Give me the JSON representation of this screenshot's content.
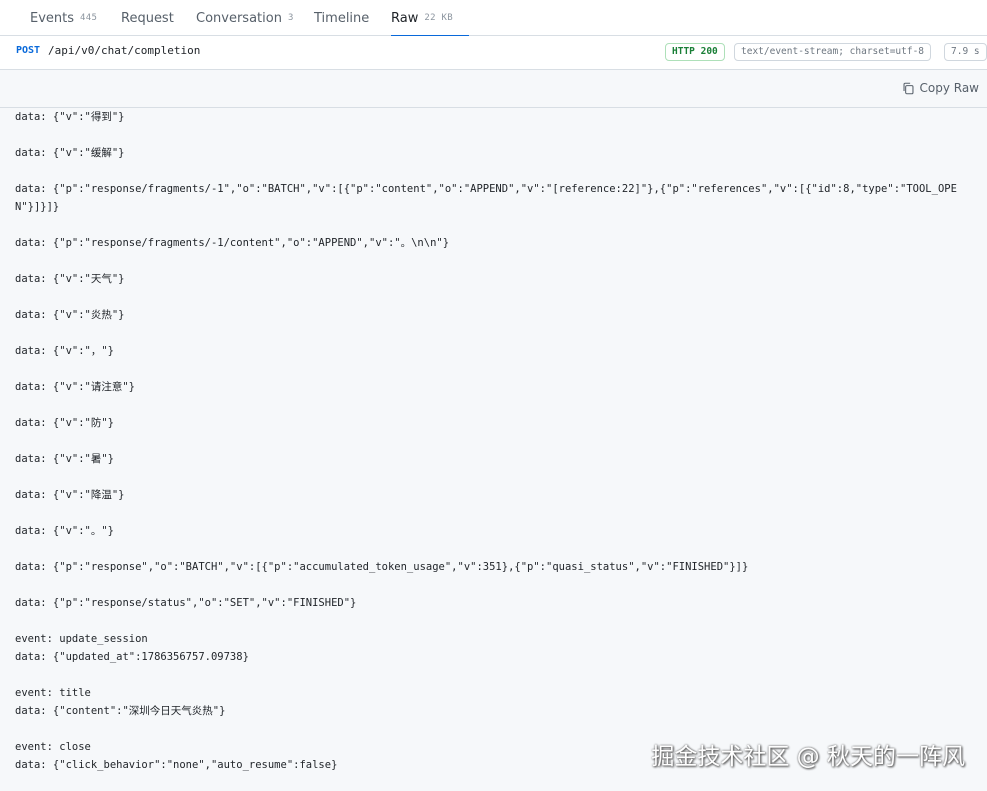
{
  "tabs": [
    {
      "label": "Events",
      "count": "445"
    },
    {
      "label": "Request",
      "count": ""
    },
    {
      "label": "Conversation",
      "count": "3"
    },
    {
      "label": "Timeline",
      "count": ""
    },
    {
      "label": "Raw",
      "count": "22 KB",
      "active": true
    }
  ],
  "request": {
    "method": "POST",
    "path": "/api/v0/chat/completion",
    "status": "HTTP 200",
    "content_type": "text/event-stream; charset=utf-8",
    "size": "7.9 s"
  },
  "toolbar": {
    "copy_label": "Copy Raw"
  },
  "raw_lines": [
    "data: {\"v\":\"得到\"}",
    "",
    "data: {\"v\":\"缓解\"}",
    "",
    "data: {\"p\":\"response/fragments/-1\",\"o\":\"BATCH\",\"v\":[{\"p\":\"content\",\"o\":\"APPEND\",\"v\":\"[reference:22]\"},{\"p\":\"references\",\"v\":[{\"id\":8,\"type\":\"TOOL_OPEN\"}]}]}",
    "",
    "data: {\"p\":\"response/fragments/-1/content\",\"o\":\"APPEND\",\"v\":\"。\\n\\n\"}",
    "",
    "data: {\"v\":\"天气\"}",
    "",
    "data: {\"v\":\"炎热\"}",
    "",
    "data: {\"v\":\"，\"}",
    "",
    "data: {\"v\":\"请注意\"}",
    "",
    "data: {\"v\":\"防\"}",
    "",
    "data: {\"v\":\"暑\"}",
    "",
    "data: {\"v\":\"降温\"}",
    "",
    "data: {\"v\":\"。\"}",
    "",
    "data: {\"p\":\"response\",\"o\":\"BATCH\",\"v\":[{\"p\":\"accumulated_token_usage\",\"v\":351},{\"p\":\"quasi_status\",\"v\":\"FINISHED\"}]}",
    "",
    "data: {\"p\":\"response/status\",\"o\":\"SET\",\"v\":\"FINISHED\"}",
    "",
    "event: update_session",
    "data: {\"updated_at\":1786356757.09738}",
    "",
    "event: title",
    "data: {\"content\":\"深圳今日天气炎热\"}",
    "",
    "event: close",
    "data: {\"click_behavior\":\"none\",\"auto_resume\":false}"
  ],
  "watermark": "掘金技术社区 @ 秋天的一阵风",
  "colors": {
    "accent": "#0969da",
    "status_ok": "#1a7f37"
  }
}
